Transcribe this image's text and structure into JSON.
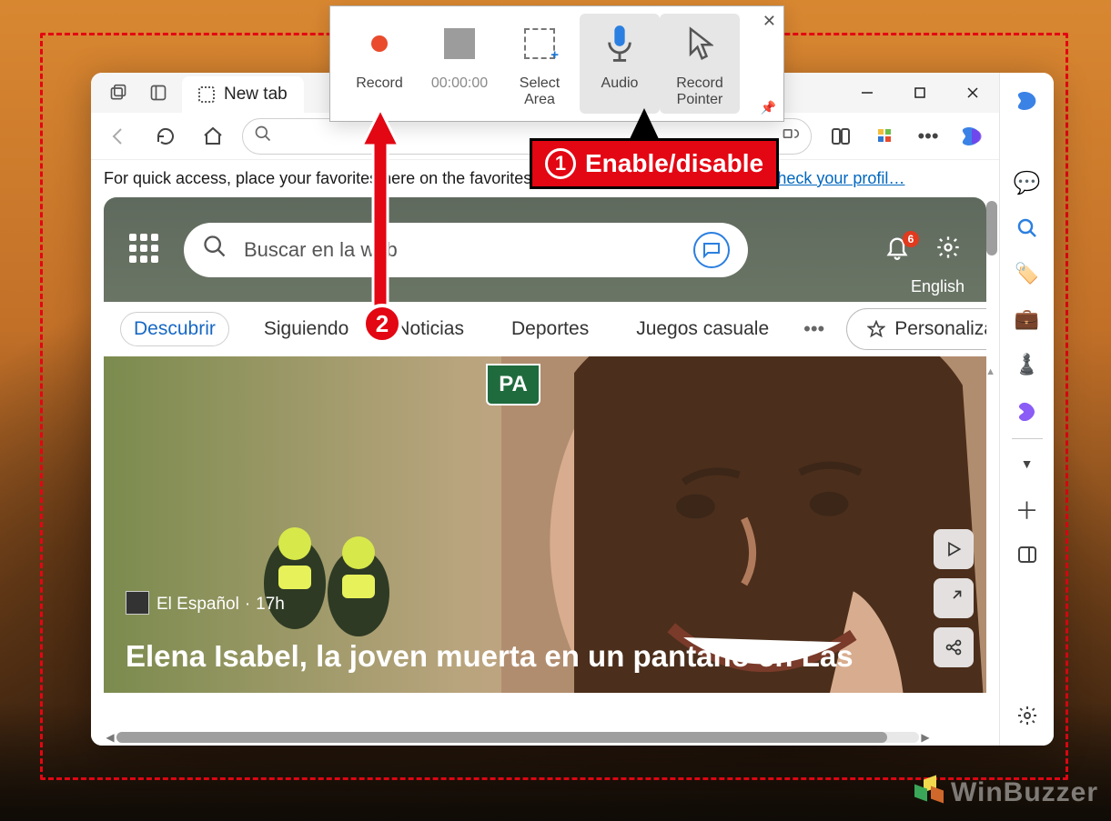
{
  "snip": {
    "record": "Record",
    "timer": "00:00:00",
    "select_area": "Select\nArea",
    "audio": "Audio",
    "record_pointer": "Record\nPointer"
  },
  "annotation": {
    "label1": "Enable/disable",
    "num1": "1",
    "num2": "2"
  },
  "browser": {
    "tab_title": "New tab",
    "favorites_msg_pre": "For quick access, place your favorites here on the favorites bar. Looking for your favorites?  ",
    "favorites_link": "Check your profil…"
  },
  "hero": {
    "search_placeholder": "Buscar en la web",
    "notif_badge": "6",
    "language": "English"
  },
  "pills": {
    "discover": "Descubrir",
    "following": "Siguiendo",
    "news": "Noticias",
    "sports": "Deportes",
    "casual": "Juegos casuale",
    "personalize": "Personalizar"
  },
  "news": {
    "sign": "PA",
    "source": "El Español",
    "time": "17h",
    "headline": "Elena Isabel, la joven muerta en un pantano en Las"
  },
  "watermark": "WinBuzzer"
}
